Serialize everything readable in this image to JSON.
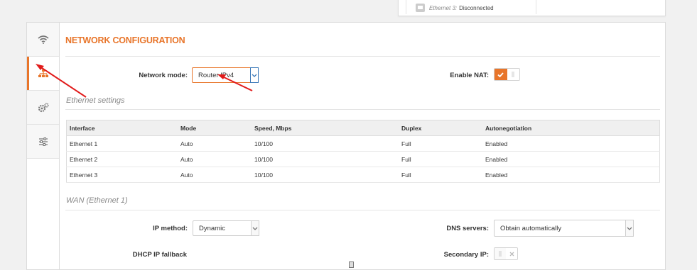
{
  "top_status": {
    "interface": "Ethernet 3:",
    "state": "Disconnected"
  },
  "sidebar": {
    "items": [
      {
        "name": "wireless-icon",
        "active": false
      },
      {
        "name": "network-icon",
        "active": true
      },
      {
        "name": "services-icon",
        "active": false
      },
      {
        "name": "settings-icon",
        "active": false
      }
    ]
  },
  "page": {
    "title": "NETWORK CONFIGURATION"
  },
  "network_mode": {
    "label": "Network mode:",
    "value": "Router IPv4"
  },
  "enable_nat": {
    "label": "Enable NAT:",
    "checked": true
  },
  "ethernet_settings": {
    "title": "Ethernet settings",
    "columns": [
      "Interface",
      "Mode",
      "Speed, Mbps",
      "Duplex",
      "Autonegotiation"
    ],
    "rows": [
      [
        "Ethernet 1",
        "Auto",
        "10/100",
        "Full",
        "Enabled"
      ],
      [
        "Ethernet 2",
        "Auto",
        "10/100",
        "Full",
        "Enabled"
      ],
      [
        "Ethernet 3",
        "Auto",
        "10/100",
        "Full",
        "Enabled"
      ]
    ]
  },
  "wan": {
    "title": "WAN (Ethernet 1)",
    "ip_method": {
      "label": "IP method:",
      "value": "Dynamic"
    },
    "dns_servers": {
      "label": "DNS servers:",
      "value": "Obtain automatically"
    },
    "dhcp_fallback": {
      "label": "DHCP IP fallback"
    },
    "secondary_ip": {
      "label": "Secondary IP:",
      "checked": false
    }
  },
  "colors": {
    "accent": "#e8752a",
    "arrow": "#e11b1b",
    "focus": "#3a78b8"
  }
}
